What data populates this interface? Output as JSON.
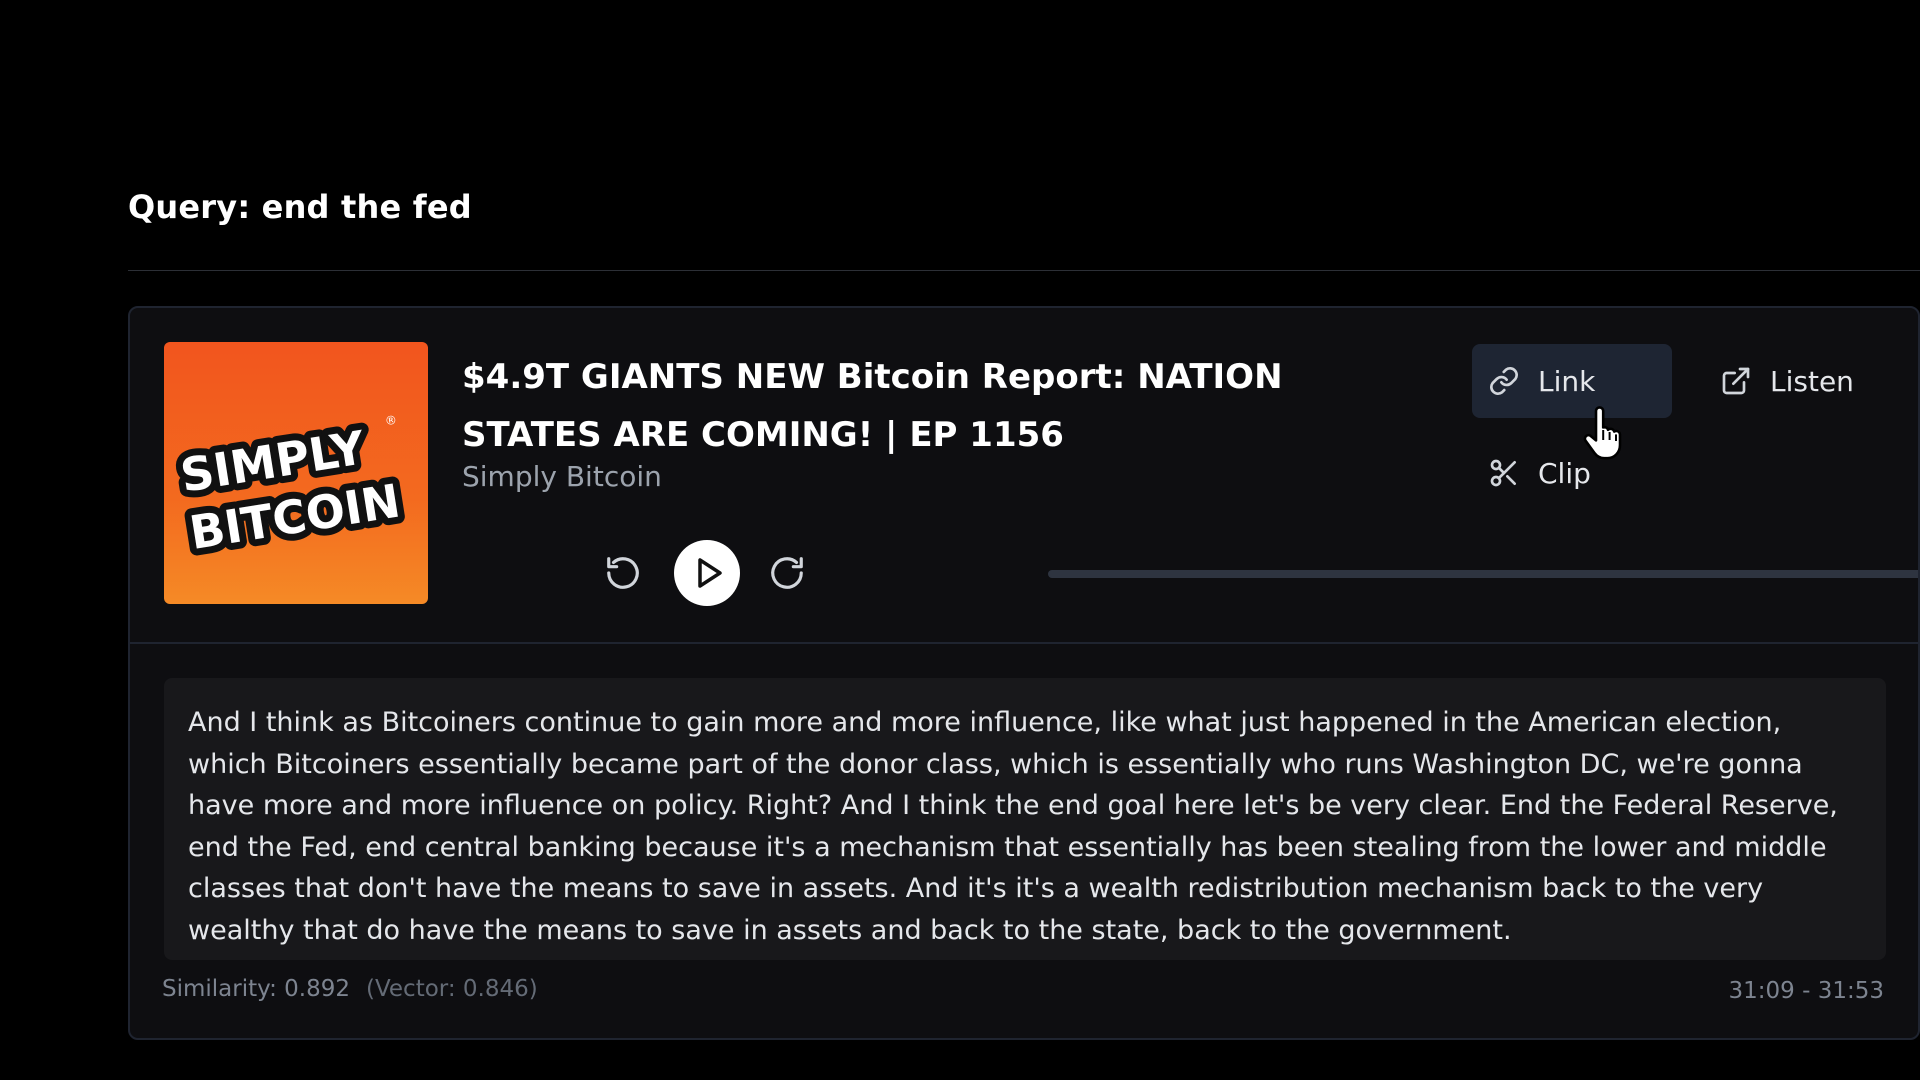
{
  "query": {
    "label": "Query: end the fed"
  },
  "result": {
    "cover_art": {
      "lines": [
        "SIMPLY",
        "BITCOIN"
      ],
      "registered_mark": "®"
    },
    "episode_title": "$4.9T GIANTS NEW Bitcoin Report: NATION STATES ARE COMING! | EP 1156",
    "podcast_name": "Simply Bitcoin",
    "actions": {
      "link_label": "Link",
      "listen_label": "Listen",
      "clip_label": "Clip"
    },
    "player": {
      "rewind_icon": "rewind-icon",
      "play_icon": "play-icon",
      "forward_icon": "forward-icon",
      "progress": 0
    },
    "transcript": "And I think as Bitcoiners continue to gain more and more influence, like what just happened in the American election, which Bitcoiners essentially became part of the donor class, which is essentially who runs Washington DC, we're gonna have more and more influence on policy. Right? And I think the end goal here let's be very clear. End the Federal Reserve, end the Fed, end central banking because it's a mechanism that essentially has been stealing from the lower and middle classes that don't have the means to save in assets. And it's it's a wealth redistribution mechanism back to the very wealthy that do have the means to save in assets and back to the state, back to the government.",
    "similarity": "Similarity: 0.892",
    "vector": "(Vector: 0.846)",
    "timestamp": "31:09 - 31:53"
  },
  "colors": {
    "background": "#000000",
    "card": "#0e0e11",
    "card_border": "#1f2430",
    "link_button_bg": "#1e2533",
    "cover_orange": "#f2551e",
    "muted_text": "#9ca3ad"
  }
}
